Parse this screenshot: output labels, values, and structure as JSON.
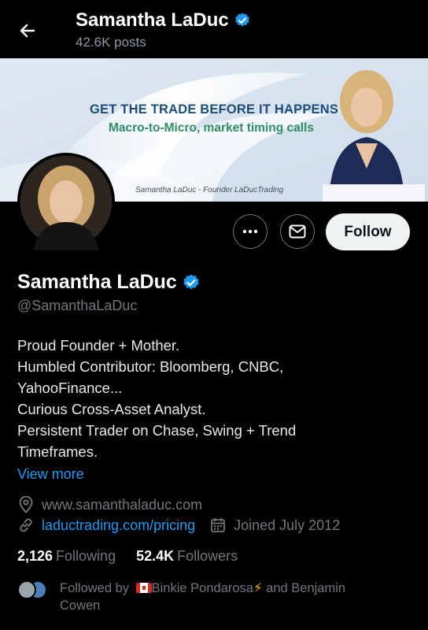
{
  "header": {
    "title": "Samantha LaDuc",
    "posts": "42.6K posts"
  },
  "banner": {
    "headline": "GET THE TRADE BEFORE IT HAPPENS",
    "subline": "Macro-to-Micro, market timing calls",
    "caption": "Samantha LaDuc - Founder LaDucTrading"
  },
  "actions": {
    "follow_label": "Follow"
  },
  "profile": {
    "name": "Samantha LaDuc",
    "handle": "@SamanthaLaDuc",
    "bio_lines": [
      "Proud Founder + Mother.",
      "Humbled Contributor: Bloomberg, CNBC,",
      "YahooFinance...",
      "Curious Cross-Asset Analyst.",
      "Persistent Trader on Chase, Swing + Trend",
      "Timeframes."
    ],
    "view_more": "View more",
    "location": "www.samanthaladuc.com",
    "website": "laductrading.com/pricing",
    "joined": "Joined July 2012"
  },
  "stats": {
    "following_count": "2,126",
    "following_label": "Following",
    "followers_count": "52.4K",
    "followers_label": "Followers"
  },
  "followed_by": {
    "prefix": "Followed by",
    "person1": "Binkie Pondarosa",
    "connector": "and Benjamin",
    "line2": "Cowen"
  },
  "colors": {
    "accent": "#1d9bf0",
    "verified": "#1d9bf0",
    "muted": "#71767b"
  }
}
